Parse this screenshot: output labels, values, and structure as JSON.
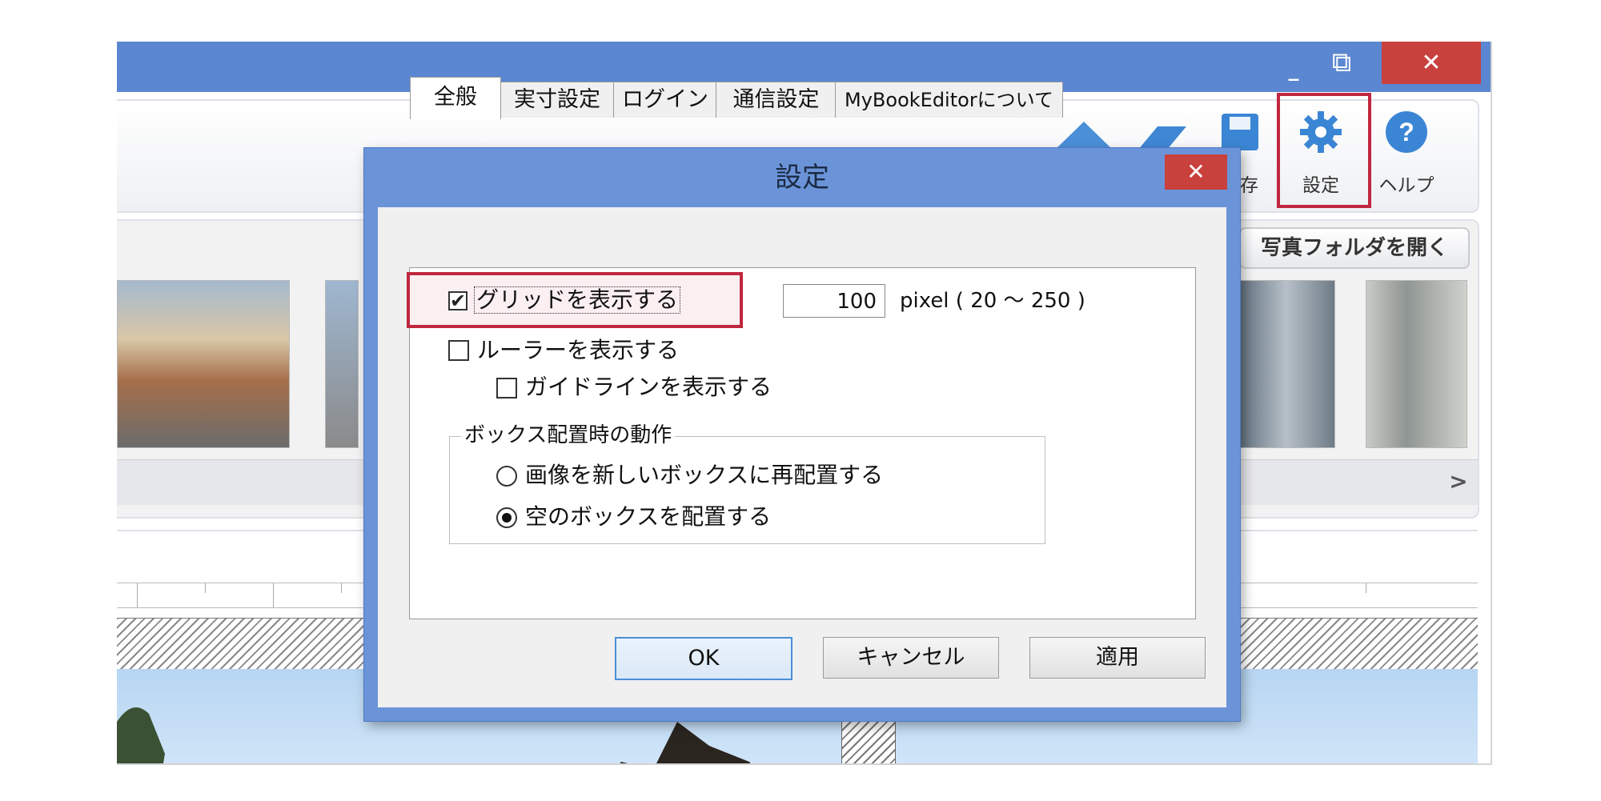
{
  "window": {
    "controls": {
      "minimize": "_",
      "maximize": "⧉",
      "close": "✕"
    },
    "title_bar_color": "#5b87d2",
    "close_color": "#c9413c"
  },
  "toolbar": {
    "save_label": "保存",
    "settings_label": "設定",
    "help_label": "ヘルプ",
    "highlight_color": "#c0273f"
  },
  "photo_panel": {
    "open_folder_label": "写真フォルダを開く",
    "next_arrow": ">"
  },
  "dialog": {
    "title": "設定",
    "close": "✕",
    "tabs": [
      {
        "label": "全般",
        "active": true
      },
      {
        "label": "実寸設定",
        "active": false
      },
      {
        "label": "ログイン",
        "active": false
      },
      {
        "label": "通信設定",
        "active": false
      },
      {
        "label": "MyBookEditorについて",
        "active": false
      }
    ],
    "show_grid": {
      "label": "グリッドを表示する",
      "checked": true
    },
    "grid_size": {
      "value": "100",
      "unit_range": "pixel ( 20 〜 250 )"
    },
    "show_ruler": {
      "label": "ルーラーを表示する",
      "checked": false
    },
    "show_guides": {
      "label": "ガイドラインを表示する",
      "checked": false
    },
    "box_group": {
      "legend": "ボックス配置時の動作",
      "options": [
        {
          "label": "画像を新しいボックスに再配置する",
          "selected": false
        },
        {
          "label": "空のボックスを配置する",
          "selected": true
        }
      ]
    },
    "buttons": {
      "ok": "OK",
      "cancel": "キャンセル",
      "apply": "適用"
    }
  }
}
